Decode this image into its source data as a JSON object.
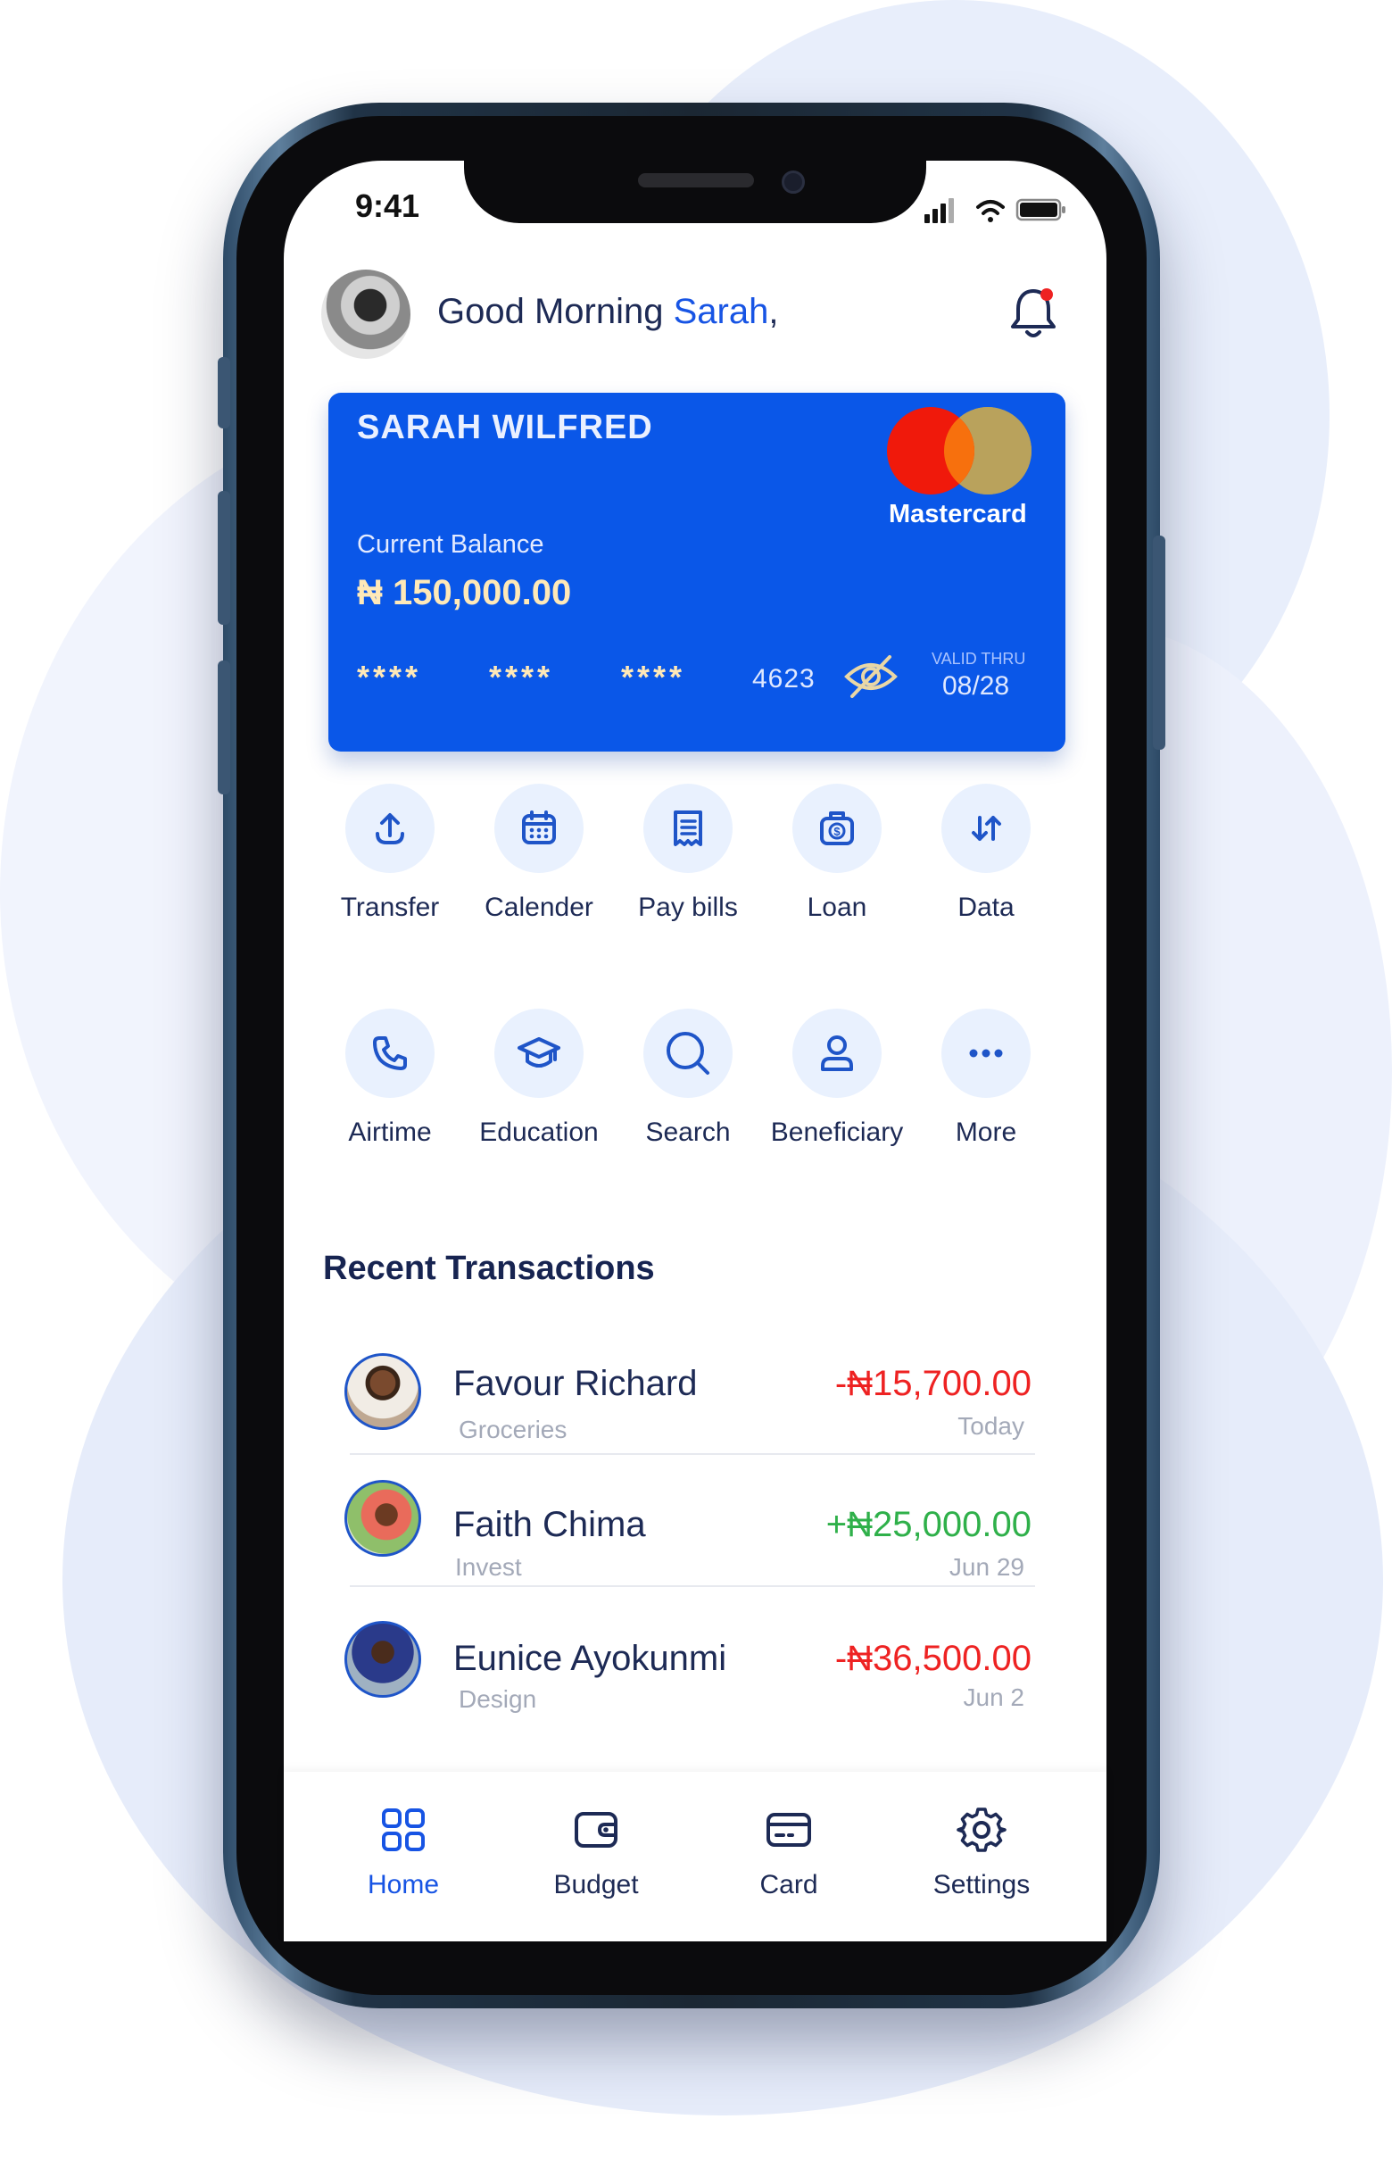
{
  "status_bar": {
    "time": "9:41"
  },
  "header": {
    "greeting_prefix": "Good Morning ",
    "user_name": "Sarah",
    "greeting_suffix": ","
  },
  "card": {
    "holder": "SARAH WILFRED",
    "brand": "Mastercard",
    "balance_label": "Current Balance",
    "balance": "₦ 150,000.00",
    "masked_groups": [
      "****",
      "****",
      "****"
    ],
    "last4": "4623",
    "valid_thru_label": "VALID THRU",
    "valid_thru": "08/28"
  },
  "quick_actions": [
    {
      "label": "Transfer",
      "icon": "upload-icon"
    },
    {
      "label": "Calender",
      "icon": "calendar-icon"
    },
    {
      "label": "Pay bills",
      "icon": "receipt-icon"
    },
    {
      "label": "Loan",
      "icon": "money-bag-icon"
    },
    {
      "label": "Data",
      "icon": "data-arrows-icon"
    },
    {
      "label": "Airtime",
      "icon": "phone-icon"
    },
    {
      "label": "Education",
      "icon": "graduation-cap-icon"
    },
    {
      "label": "Search",
      "icon": "search-icon"
    },
    {
      "label": "Beneficiary",
      "icon": "user-icon"
    },
    {
      "label": "More",
      "icon": "more-dots-icon"
    }
  ],
  "transactions_title": "Recent Transactions",
  "transactions": [
    {
      "name": "Favour Richard",
      "category": "Groceries",
      "amount": "-₦15,700.00",
      "date": "Today",
      "direction": "debit"
    },
    {
      "name": "Faith Chima",
      "category": "Invest",
      "amount": "+₦25,000.00",
      "date": "Jun 29",
      "direction": "credit"
    },
    {
      "name": "Eunice Ayokunmi",
      "category": "Design",
      "amount": "-₦36,500.00",
      "date": "Jun 2",
      "direction": "debit"
    }
  ],
  "bottom_nav": [
    {
      "label": "Home",
      "icon": "grid-icon",
      "active": true
    },
    {
      "label": "Budget",
      "icon": "wallet-icon",
      "active": false
    },
    {
      "label": "Card",
      "icon": "credit-card-icon",
      "active": false
    },
    {
      "label": "Settings",
      "icon": "gear-icon",
      "active": false
    }
  ],
  "colors": {
    "accent": "#1754e4",
    "card": "#0a57e8",
    "debit": "#ee2222",
    "credit": "#2fb04a",
    "text": "#1d2a55"
  }
}
